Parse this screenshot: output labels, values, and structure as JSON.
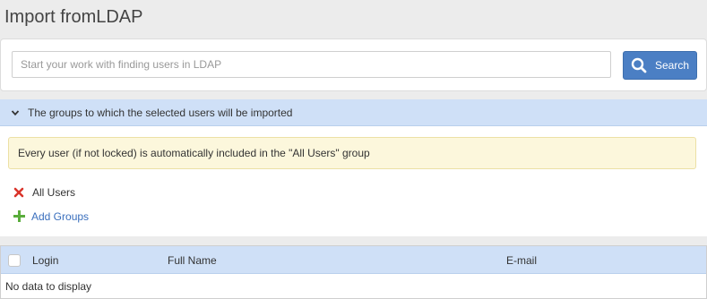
{
  "page": {
    "title": "Import fromLDAP"
  },
  "search": {
    "placeholder": "Start your work with finding users in LDAP",
    "value": "",
    "button_label": "Search"
  },
  "groups": {
    "header_label": "The groups to which the selected users will be imported",
    "info_text": "Every user (if not locked) is automatically included in the \"All Users\" group",
    "items": [
      {
        "label": "All Users"
      }
    ],
    "add_label": "Add Groups"
  },
  "grid": {
    "columns": [
      "Login",
      "Full Name",
      "E-mail"
    ],
    "empty_text": "No data to display"
  },
  "colors": {
    "accent": "#4b7fc4",
    "header_bg": "#cfe0f7",
    "info_bg": "#fcf7dc",
    "remove": "#d9342b",
    "add": "#5aad3c"
  },
  "icons": {
    "search_button": "search-icon",
    "groups_toggle": "chevron-down-icon",
    "remove_group": "remove-icon",
    "add_groups": "plus-icon"
  }
}
